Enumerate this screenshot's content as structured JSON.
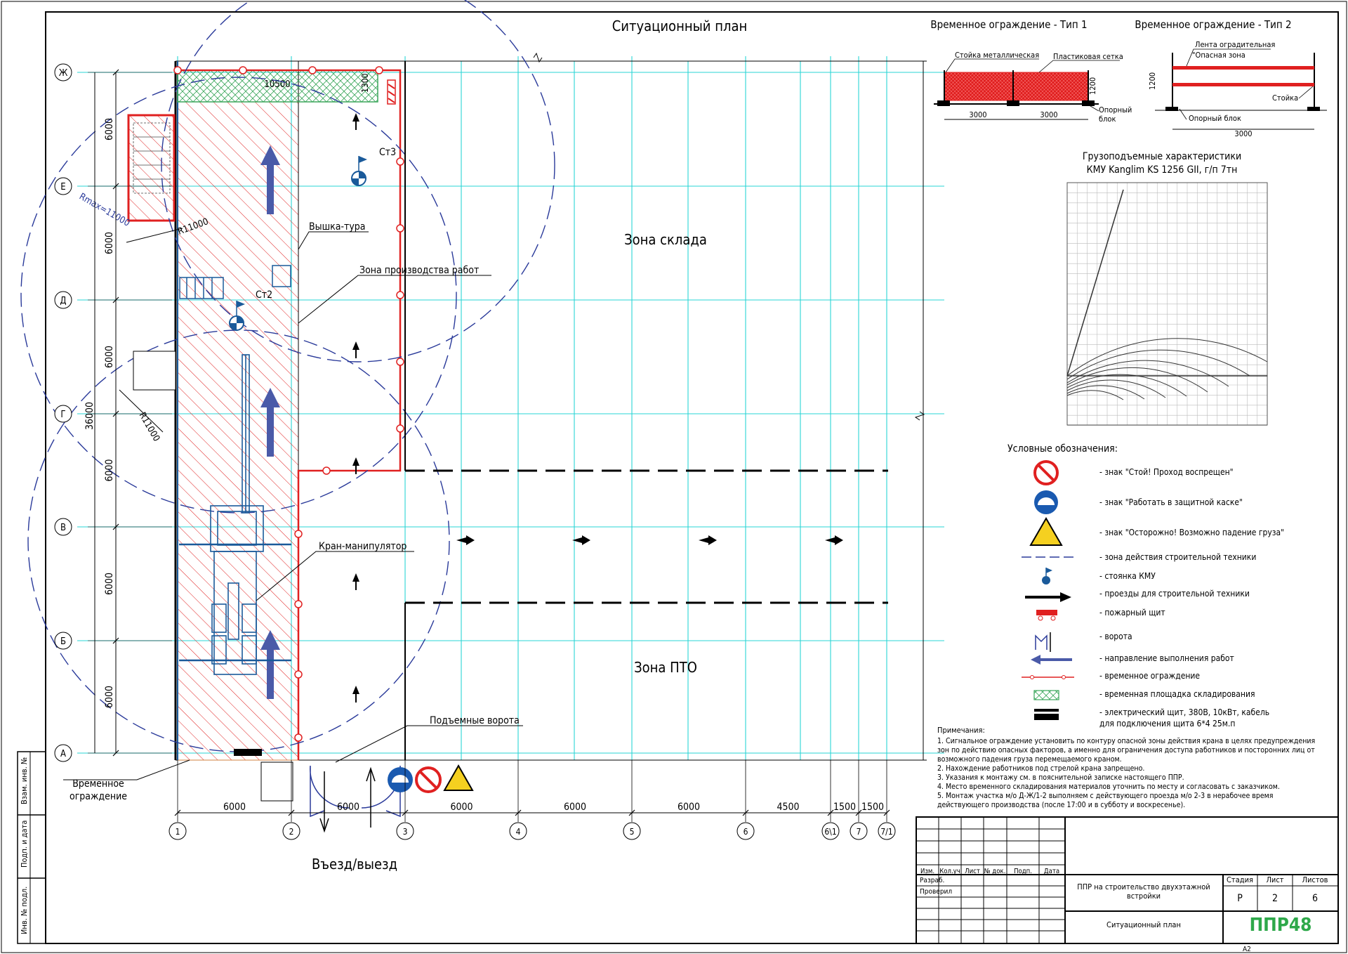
{
  "title": "Ситуационный план",
  "zones": {
    "warehouse": "Зона склада",
    "pto": "Зона ПТО"
  },
  "callouts": {
    "tower": "Вышка-тура",
    "work_zone": "Зона производства работ",
    "crane": "Кран-манипулятор",
    "lift_gate": "Подъемные ворота",
    "temp_fence_1": "Временное",
    "temp_fence_2": "ограждение",
    "entry": "Въезд/выезд",
    "st2": "Ст2",
    "st3": "Ст3",
    "rmax": "Rmax=11000",
    "r1": "R11000",
    "r2": "R11000",
    "dim_10500": "10500",
    "dim_1300": "1300",
    "dim_total": "36000"
  },
  "row_axes": [
    "Ж",
    "Е",
    "Д",
    "Г",
    "В",
    "Б",
    "А"
  ],
  "col_axes": [
    "1",
    "2",
    "3",
    "4",
    "5",
    "6",
    "6\\1",
    "7",
    "7/1"
  ],
  "col_dims": [
    "6000",
    "6000",
    "6000",
    "6000",
    "6000",
    "4500",
    "1500",
    "1500"
  ],
  "row_dims": [
    "6000",
    "6000",
    "6000",
    "6000",
    "6000",
    "6000"
  ],
  "fence1": {
    "title": "Временное ограждение - Тип 1",
    "post": "Стойка металлическая",
    "mesh": "Пластиковая сетка",
    "base1": "Опорный",
    "base2": "блок",
    "h": "1200",
    "w1": "3000",
    "w2": "3000"
  },
  "fence2": {
    "title": "Временное ограждение - Тип 2",
    "tape": "Лента оградительная",
    "danger": "\"Опасная зона",
    "post": "Стойка",
    "base": "Опорный блок",
    "h": "1200",
    "w": "3000"
  },
  "crane_chart": {
    "title1": "Грузоподъемные характеристики",
    "title2": "КМУ Kanglim KS 1256 GII, г/п 7тн"
  },
  "legend": {
    "title": "Условные обозначения:",
    "items": [
      "- знак \"Стой! Проход воспрещен\"",
      "- знак \"Работать в защитной каске\"",
      "- знак \"Осторожно! Возможно падение груза\"",
      "- зона действия строительной техники",
      "- стоянка КМУ",
      "- проезды для строительной техники",
      "- пожарный щит",
      "- ворота",
      "- направление выполнения работ",
      "- временное ограждение",
      "- временная площадка складирования",
      "- электрический щит, 380В, 10кВт, кабель",
      "для подключения щита 6*4 25м.п"
    ]
  },
  "notes": {
    "title": "Примечания:",
    "lines": [
      "1. Сигнальное ограждение установить по контуру опасной зоны действия крана в целях предупреждения",
      "зон по действию опасных факторов, а именно для ограничения доступа работников и посторонних лиц от",
      "возможного падения груза перемещаемого краном.",
      "2. Нахождение работников под стрелой крана запрещено.",
      "3. Указания к монтажу см. в пояснительной записке настоящего ППР.",
      "4. Место временного складирования материалов уточнить по месту и согласовать с заказчиком.",
      "5. Монтаж участка м/о Д-Ж/1-2 выполняем с действующего проезда м/о 2-3 в нерабочее время",
      "действующего производства (после 17:00 и в субботу и воскресенье)."
    ]
  },
  "stamp": {
    "cols": [
      "Изм.",
      "Кол.уч",
      "Лист",
      "№ док.",
      "Подп.",
      "Дата"
    ],
    "rows": [
      "Разраб.",
      "Проверил"
    ],
    "project1": "ППР на строительство двухэтажной",
    "project2": "встройки",
    "sheet_title": "Ситуационный план",
    "stage_h": "Стадия",
    "sheet_h": "Лист",
    "sheets_h": "Листов",
    "stage": "Р",
    "sheet": "2",
    "sheets": "6",
    "logo": "ППР48",
    "format": "А2"
  },
  "side_labels": [
    "Взам. инв. №",
    "Подп. и дата",
    "Инв. № подл."
  ],
  "colors": {
    "grid": "#2ad4d4",
    "fence": "#e02020",
    "zone": "#2a3a9a",
    "equipment": "#1a5a9a",
    "storage": "#3aa65a",
    "logo": "#2ea84a"
  }
}
